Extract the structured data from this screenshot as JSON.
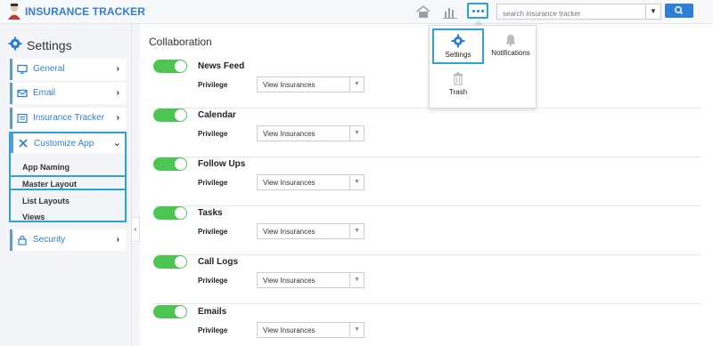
{
  "app": {
    "title": "INSURANCE TRACKER"
  },
  "header": {
    "search_placeholder": "search insurance tracker"
  },
  "more_menu": {
    "items": [
      {
        "label": "Settings",
        "icon": "gear-icon"
      },
      {
        "label": "Notifications",
        "icon": "bell-icon"
      },
      {
        "label": "Trash",
        "icon": "trash-icon"
      }
    ]
  },
  "sidebar": {
    "title": "Settings",
    "items": [
      {
        "label": "General",
        "icon": "monitor-icon"
      },
      {
        "label": "Email",
        "icon": "envelope-icon"
      },
      {
        "label": "Insurance Tracker",
        "icon": "list-icon"
      },
      {
        "label": "Customize App",
        "icon": "tools-icon"
      },
      {
        "label": "Security",
        "icon": "lock-icon"
      }
    ],
    "customize_sub": [
      "App Naming",
      "Master Layout",
      "List Layouts",
      "Views"
    ]
  },
  "main": {
    "section_title": "Collaboration",
    "privilege_label": "Privilege",
    "rows": [
      {
        "title": "News Feed",
        "enabled": true,
        "privilege": "View Insurances"
      },
      {
        "title": "Calendar",
        "enabled": true,
        "privilege": "View Insurances"
      },
      {
        "title": "Follow Ups",
        "enabled": true,
        "privilege": "View Insurances"
      },
      {
        "title": "Tasks",
        "enabled": true,
        "privilege": "View Insurances"
      },
      {
        "title": "Call Logs",
        "enabled": true,
        "privilege": "View Insurances"
      },
      {
        "title": "Emails",
        "enabled": true,
        "privilege": "View Insurances"
      }
    ]
  },
  "colors": {
    "accent": "#2f7fd6",
    "highlight_border": "#29a3e0",
    "toggle_on": "#4cc552"
  }
}
